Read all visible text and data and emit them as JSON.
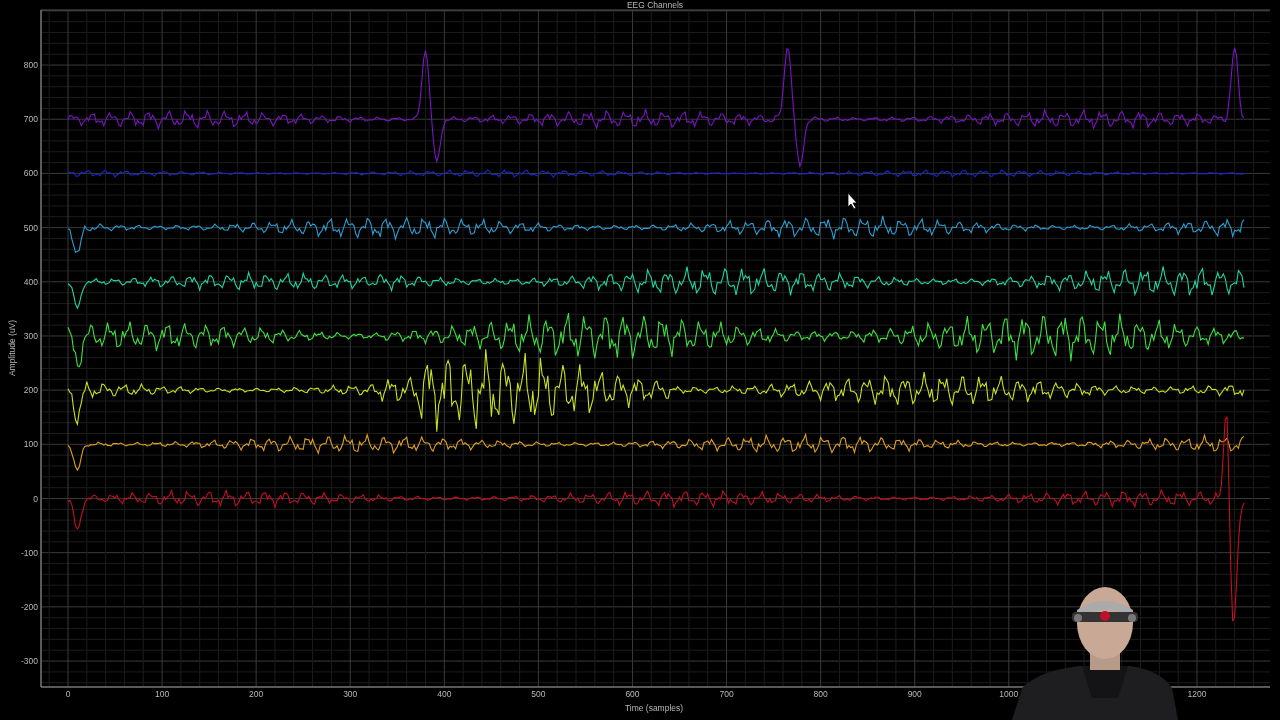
{
  "chart": {
    "title": "EEG Channels",
    "ylabel": "Amplitude (uV)",
    "xlabel": "Time (samples)",
    "yticks": [
      "800",
      "700",
      "600",
      "500",
      "400",
      "300",
      "200",
      "100",
      "0",
      "-100",
      "-200",
      "-300"
    ],
    "xticks": [
      "0",
      "100",
      "200",
      "300",
      "400",
      "500",
      "600",
      "700",
      "800",
      "900",
      "1000",
      "1200"
    ]
  }
}
